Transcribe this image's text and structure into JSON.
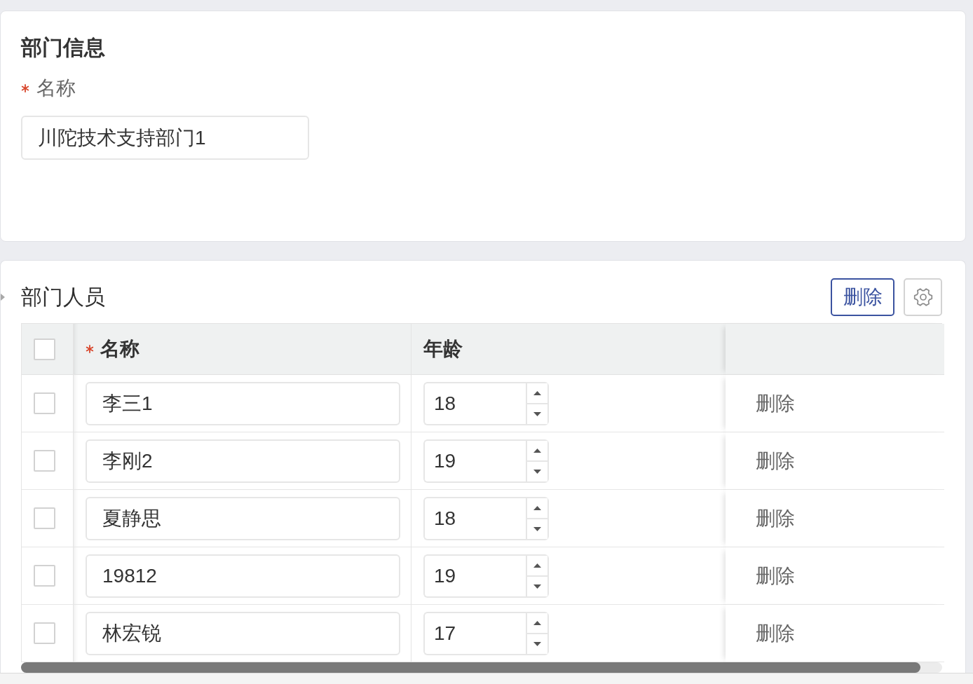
{
  "department_info": {
    "title": "部门信息",
    "fields": [
      {
        "label": "名称",
        "required": true,
        "value": "川陀技术支持部门1"
      }
    ]
  },
  "department_members": {
    "title": "部门人员",
    "toolbar": [
      {
        "kind": "text",
        "label": "删除"
      },
      {
        "kind": "settings"
      }
    ],
    "table": {
      "select_all": {
        "checked": false
      },
      "columns": [
        {
          "label": "名称",
          "required": true
        },
        {
          "label": "年龄",
          "required": false
        }
      ],
      "rows": [
        {
          "checked": false,
          "name": "李三1",
          "age": "18",
          "action": "删除"
        },
        {
          "checked": false,
          "name": "李刚2",
          "age": "19",
          "action": "删除"
        },
        {
          "checked": false,
          "name": "夏静思",
          "age": "18",
          "action": "删除"
        },
        {
          "checked": false,
          "name": "19812",
          "age": "19",
          "action": "删除"
        },
        {
          "checked": false,
          "name": "林宏锐",
          "age": "17",
          "action": "删除"
        }
      ]
    }
  }
}
